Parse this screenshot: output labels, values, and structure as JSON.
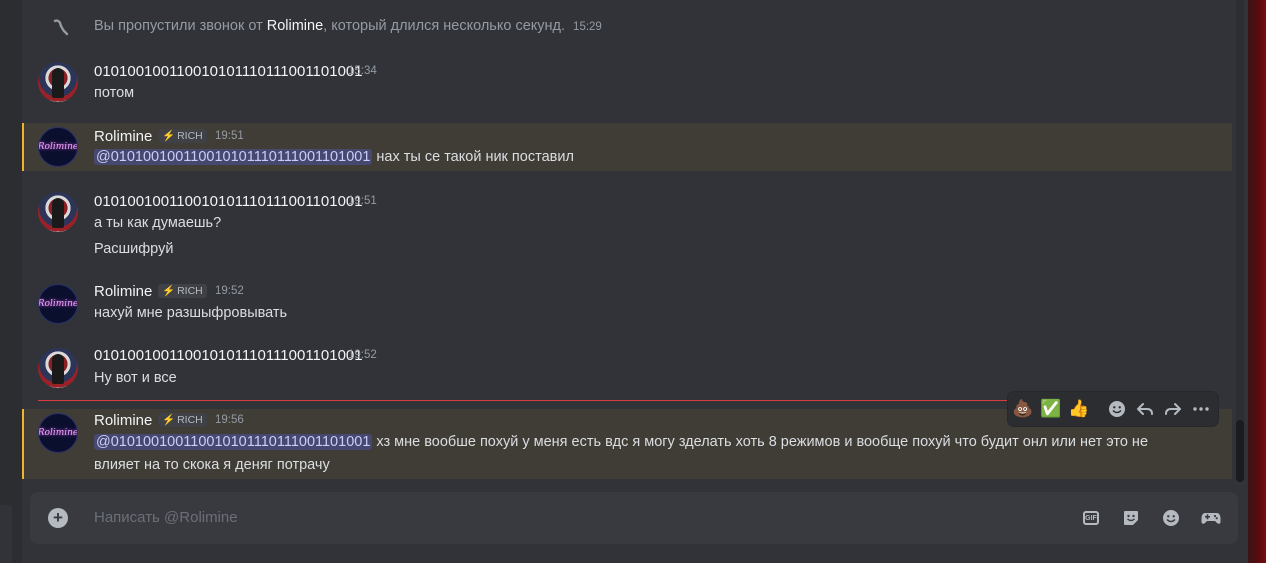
{
  "system_message": {
    "prefix": "Вы пропустили звонок от",
    "caller": "Rolimine",
    "suffix": ", который длился несколько секунд.",
    "time": "15:29"
  },
  "messages": [
    {
      "user": "010100100110010101110111001101001",
      "time": "15:34",
      "lines": [
        "потом"
      ]
    },
    {
      "user": "Rolimine",
      "badge": "RICH",
      "time": "19:51",
      "mention": "@010100100110010101110111001101001",
      "lines": [
        "нах ты се такой ник поставил"
      ]
    },
    {
      "user": "010100100110010101110111001101001",
      "time": "19:51",
      "lines": [
        "а ты как думаешь?",
        "Расшифруй"
      ]
    },
    {
      "user": "Rolimine",
      "badge": "RICH",
      "time": "19:52",
      "lines": [
        "нахуй мне разшыфровывать"
      ]
    },
    {
      "user": "010100100110010101110111001101001",
      "time": "19:52",
      "lines": [
        "Ну вот и все"
      ]
    },
    {
      "user": "Rolimine",
      "badge": "RICH",
      "time": "19:56",
      "mention": "@010100100110010101110111001101001",
      "lines": [
        "хз мне вообше похуй у меня есть вдс я могу зделать хоть 8 режимов и вообще похуй что будит онл или нет это не",
        "влияет на то скока я деняг потрачу"
      ]
    }
  ],
  "avatar_text": "Rolimine",
  "toolbar": {
    "reactions": [
      "💩",
      "✅",
      "👍"
    ],
    "icons": [
      "add-reaction-icon",
      "reply-icon",
      "forward-icon",
      "more-icon"
    ]
  },
  "composer": {
    "placeholder": "Написать @Rolimine"
  },
  "colors": {
    "mention_bar": "#f0b232",
    "new_divider": "#d83c3e",
    "badge_bolt": "#00a8fc"
  }
}
